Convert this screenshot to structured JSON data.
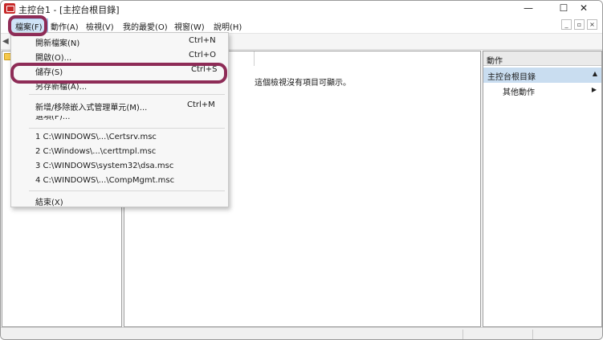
{
  "window": {
    "title": "主控台1 - [主控台根目錄]",
    "minimize_glyph": "—",
    "maximize_glyph": "☐",
    "close_glyph": "✕"
  },
  "menubar": {
    "items": [
      "檔案(F)",
      "動作(A)",
      "檢視(V)",
      "我的最愛(O)",
      "視窗(W)",
      "說明(H)"
    ],
    "mdi_min": "_",
    "mdi_restore": "▫",
    "mdi_close": "×"
  },
  "toolbar": {
    "back_glyph": "◀"
  },
  "center": {
    "empty_message": "這個檢視沒有項目可顯示。"
  },
  "actions_pane": {
    "header": "動作",
    "section": "主控台根目錄",
    "collapse_glyph": "▲",
    "item": "其他動作",
    "item_arrow": "▶"
  },
  "file_menu": {
    "items": [
      {
        "label": "開新檔案(N)",
        "shortcut": "Ctrl+N"
      },
      {
        "label": "開啟(O)...",
        "shortcut": "Ctrl+O"
      },
      {
        "label": "儲存(S)",
        "shortcut": "Ctrl+S"
      },
      {
        "label": "另存新檔(A)...",
        "shortcut": ""
      },
      {
        "label": "新增/移除嵌入式管理單元(M)...",
        "shortcut": "Ctrl+M"
      },
      {
        "label": "選項(P)...",
        "shortcut": ""
      },
      {
        "label": "1 C:\\WINDOWS\\...\\Certsrv.msc",
        "shortcut": ""
      },
      {
        "label": "2 C:\\Windows\\...\\certtmpl.msc",
        "shortcut": ""
      },
      {
        "label": "3 C:\\WINDOWS\\system32\\dsa.msc",
        "shortcut": ""
      },
      {
        "label": "4 C:\\WINDOWS\\...\\CompMgmt.msc",
        "shortcut": ""
      },
      {
        "label": "結束(X)",
        "shortcut": ""
      }
    ]
  },
  "colors": {
    "highlight_ring": "#8e2c57",
    "menu_selected": "#cfe3f7",
    "actions_section": "#c9ddf0"
  }
}
